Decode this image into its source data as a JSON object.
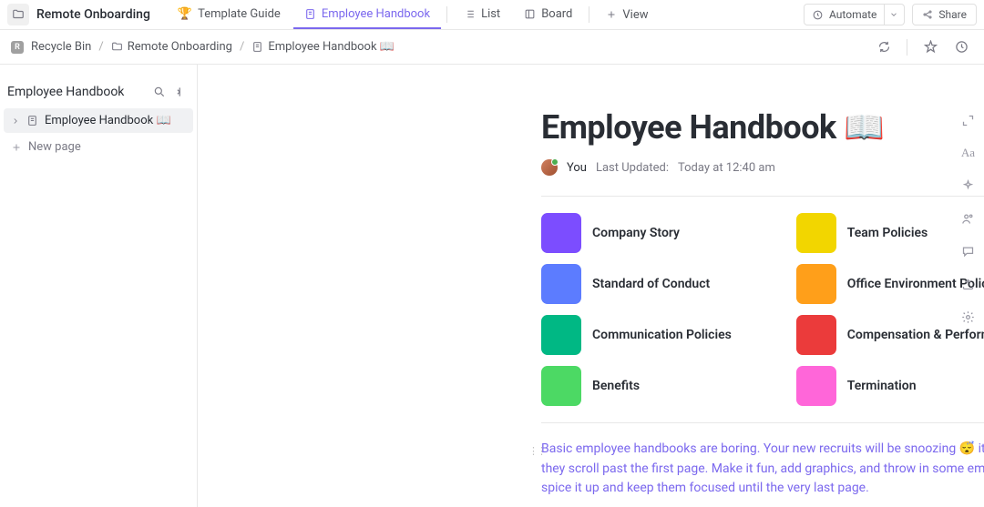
{
  "top": {
    "workspace": "Remote Onboarding",
    "tabs": [
      {
        "icon": "🏆",
        "label": "Template Guide"
      },
      {
        "icon": "doc",
        "label": "Employee Handbook"
      },
      {
        "icon": "list",
        "label": "List"
      },
      {
        "icon": "board",
        "label": "Board"
      }
    ],
    "view": "View",
    "automate": "Automate",
    "share": "Share"
  },
  "breadcrumb": {
    "badge": "R",
    "items": [
      "Recycle Bin",
      "Remote Onboarding",
      "Employee Handbook 📖"
    ]
  },
  "sidebar": {
    "title": "Employee Handbook",
    "item": "Employee Handbook 📖",
    "new_page": "New page"
  },
  "page": {
    "title": "Employee Handbook 📖",
    "author": "You",
    "updated_label": "Last Updated:",
    "updated_value": "Today at 12:40 am"
  },
  "cards": [
    {
      "color": "#7c4dff",
      "title": "Company Story"
    },
    {
      "color": "#f2d600",
      "title": "Team Policies"
    },
    {
      "color": "#5c7cff",
      "title": "Standard of Conduct"
    },
    {
      "color": "#ff9f1a",
      "title": "Office Environment Policies"
    },
    {
      "color": "#00b884",
      "title": "Communication Policies"
    },
    {
      "color": "#eb3b3b",
      "title": "Compensation & Performance Re…"
    },
    {
      "color": "#4cd964",
      "title": "Benefits"
    },
    {
      "color": "#ff66d9",
      "title": "Termination"
    }
  ],
  "body_text": "Basic employee handbooks are boring. Your new recruits will be snoozing 😴  it up before they scroll past the first page. Make it fun, add graphics, and throw in some emojis to spice it up and keep them focused until the very last page."
}
